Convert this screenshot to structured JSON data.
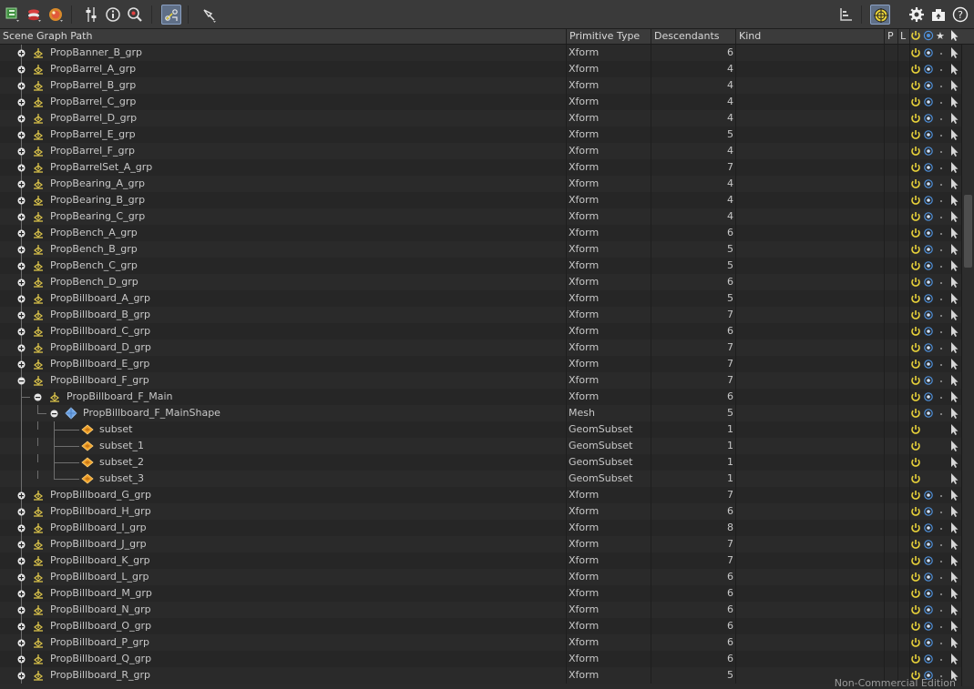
{
  "toolbar": {
    "left_tools": [
      {
        "name": "add-node-icon"
      },
      {
        "name": "layer-stack-icon"
      },
      {
        "name": "material-ball-icon"
      },
      {
        "name": "tuning-sliders-icon"
      },
      {
        "name": "info-circle-icon"
      },
      {
        "name": "search-zoom-icon"
      },
      {
        "name": "link-toggle-icon",
        "active": true
      },
      {
        "name": "pen-tool-icon"
      }
    ],
    "right_tools": [
      {
        "name": "hierarchy-axis-icon"
      },
      {
        "name": "target-crosshair-icon",
        "active": true
      },
      {
        "name": "gear-icon"
      },
      {
        "name": "export-camera-icon"
      },
      {
        "name": "help-icon",
        "glyph": "?"
      }
    ]
  },
  "columns": {
    "path": "Scene Graph Path",
    "type": "Primitive Type",
    "descendants": "Descendants",
    "kind": "Kind",
    "p": "P",
    "l": "L",
    "star": "★"
  },
  "colors": {
    "accent_yellow": "#e8d23a",
    "visible_blue": "#4e8fd9",
    "row_text": "#c8c8c8",
    "group_icon": "#d9c24a",
    "mesh_icon": "#6fa5e6",
    "subset_icon": "#f0a22a"
  },
  "rows": [
    {
      "name": "PropBanner_B_grp",
      "type": "Xform",
      "desc": "6",
      "depth": 0,
      "icon": "xform",
      "exp": "plus",
      "vis": true
    },
    {
      "name": "PropBarrel_A_grp",
      "type": "Xform",
      "desc": "4",
      "depth": 0,
      "icon": "xform",
      "exp": "plus",
      "vis": true
    },
    {
      "name": "PropBarrel_B_grp",
      "type": "Xform",
      "desc": "4",
      "depth": 0,
      "icon": "xform",
      "exp": "plus",
      "vis": true
    },
    {
      "name": "PropBarrel_C_grp",
      "type": "Xform",
      "desc": "4",
      "depth": 0,
      "icon": "xform",
      "exp": "plus",
      "vis": true
    },
    {
      "name": "PropBarrel_D_grp",
      "type": "Xform",
      "desc": "4",
      "depth": 0,
      "icon": "xform",
      "exp": "plus",
      "vis": true
    },
    {
      "name": "PropBarrel_E_grp",
      "type": "Xform",
      "desc": "5",
      "depth": 0,
      "icon": "xform",
      "exp": "plus",
      "vis": true
    },
    {
      "name": "PropBarrel_F_grp",
      "type": "Xform",
      "desc": "4",
      "depth": 0,
      "icon": "xform",
      "exp": "plus",
      "vis": true
    },
    {
      "name": "PropBarrelSet_A_grp",
      "type": "Xform",
      "desc": "7",
      "depth": 0,
      "icon": "xform",
      "exp": "plus",
      "vis": true
    },
    {
      "name": "PropBearing_A_grp",
      "type": "Xform",
      "desc": "4",
      "depth": 0,
      "icon": "xform",
      "exp": "plus",
      "vis": true
    },
    {
      "name": "PropBearing_B_grp",
      "type": "Xform",
      "desc": "4",
      "depth": 0,
      "icon": "xform",
      "exp": "plus",
      "vis": true
    },
    {
      "name": "PropBearing_C_grp",
      "type": "Xform",
      "desc": "4",
      "depth": 0,
      "icon": "xform",
      "exp": "plus",
      "vis": true
    },
    {
      "name": "PropBench_A_grp",
      "type": "Xform",
      "desc": "6",
      "depth": 0,
      "icon": "xform",
      "exp": "plus",
      "vis": true
    },
    {
      "name": "PropBench_B_grp",
      "type": "Xform",
      "desc": "5",
      "depth": 0,
      "icon": "xform",
      "exp": "plus",
      "vis": true
    },
    {
      "name": "PropBench_C_grp",
      "type": "Xform",
      "desc": "5",
      "depth": 0,
      "icon": "xform",
      "exp": "plus",
      "vis": true
    },
    {
      "name": "PropBench_D_grp",
      "type": "Xform",
      "desc": "6",
      "depth": 0,
      "icon": "xform",
      "exp": "plus",
      "vis": true
    },
    {
      "name": "PropBillboard_A_grp",
      "type": "Xform",
      "desc": "5",
      "depth": 0,
      "icon": "xform",
      "exp": "plus",
      "vis": true
    },
    {
      "name": "PropBillboard_B_grp",
      "type": "Xform",
      "desc": "7",
      "depth": 0,
      "icon": "xform",
      "exp": "plus",
      "vis": true
    },
    {
      "name": "PropBillboard_C_grp",
      "type": "Xform",
      "desc": "6",
      "depth": 0,
      "icon": "xform",
      "exp": "plus",
      "vis": true
    },
    {
      "name": "PropBillboard_D_grp",
      "type": "Xform",
      "desc": "7",
      "depth": 0,
      "icon": "xform",
      "exp": "plus",
      "vis": true
    },
    {
      "name": "PropBillboard_E_grp",
      "type": "Xform",
      "desc": "7",
      "depth": 0,
      "icon": "xform",
      "exp": "plus",
      "vis": true
    },
    {
      "name": "PropBillboard_F_grp",
      "type": "Xform",
      "desc": "7",
      "depth": 0,
      "icon": "xform",
      "exp": "minus",
      "vis": true
    },
    {
      "name": "PropBillboard_F_Main",
      "type": "Xform",
      "desc": "6",
      "depth": 1,
      "icon": "xform",
      "exp": "minus",
      "vis": true
    },
    {
      "name": "PropBillboard_F_MainShape",
      "type": "Mesh",
      "desc": "5",
      "depth": 2,
      "icon": "mesh",
      "exp": "minus",
      "vis": true
    },
    {
      "name": "subset",
      "type": "GeomSubset",
      "desc": "1",
      "depth": 3,
      "icon": "subset",
      "exp": "none",
      "vis": false
    },
    {
      "name": "subset_1",
      "type": "GeomSubset",
      "desc": "1",
      "depth": 3,
      "icon": "subset",
      "exp": "none",
      "vis": false
    },
    {
      "name": "subset_2",
      "type": "GeomSubset",
      "desc": "1",
      "depth": 3,
      "icon": "subset",
      "exp": "none",
      "vis": false
    },
    {
      "name": "subset_3",
      "type": "GeomSubset",
      "desc": "1",
      "depth": 3,
      "icon": "subset",
      "exp": "none",
      "vis": false
    },
    {
      "name": "PropBillboard_G_grp",
      "type": "Xform",
      "desc": "7",
      "depth": 0,
      "icon": "xform",
      "exp": "plus",
      "vis": true
    },
    {
      "name": "PropBillboard_H_grp",
      "type": "Xform",
      "desc": "6",
      "depth": 0,
      "icon": "xform",
      "exp": "plus",
      "vis": true
    },
    {
      "name": "PropBillboard_I_grp",
      "type": "Xform",
      "desc": "8",
      "depth": 0,
      "icon": "xform",
      "exp": "plus",
      "vis": true
    },
    {
      "name": "PropBillboard_J_grp",
      "type": "Xform",
      "desc": "7",
      "depth": 0,
      "icon": "xform",
      "exp": "plus",
      "vis": true
    },
    {
      "name": "PropBillboard_K_grp",
      "type": "Xform",
      "desc": "7",
      "depth": 0,
      "icon": "xform",
      "exp": "plus",
      "vis": true
    },
    {
      "name": "PropBillboard_L_grp",
      "type": "Xform",
      "desc": "6",
      "depth": 0,
      "icon": "xform",
      "exp": "plus",
      "vis": true
    },
    {
      "name": "PropBillboard_M_grp",
      "type": "Xform",
      "desc": "6",
      "depth": 0,
      "icon": "xform",
      "exp": "plus",
      "vis": true
    },
    {
      "name": "PropBillboard_N_grp",
      "type": "Xform",
      "desc": "6",
      "depth": 0,
      "icon": "xform",
      "exp": "plus",
      "vis": true
    },
    {
      "name": "PropBillboard_O_grp",
      "type": "Xform",
      "desc": "6",
      "depth": 0,
      "icon": "xform",
      "exp": "plus",
      "vis": true
    },
    {
      "name": "PropBillboard_P_grp",
      "type": "Xform",
      "desc": "6",
      "depth": 0,
      "icon": "xform",
      "exp": "plus",
      "vis": true
    },
    {
      "name": "PropBillboard_Q_grp",
      "type": "Xform",
      "desc": "6",
      "depth": 0,
      "icon": "xform",
      "exp": "plus",
      "vis": true
    },
    {
      "name": "PropBillboard_R_grp",
      "type": "Xform",
      "desc": "5",
      "depth": 0,
      "icon": "xform",
      "exp": "plus",
      "vis": true
    }
  ],
  "footer": {
    "watermark": "Non-Commercial Edition"
  }
}
